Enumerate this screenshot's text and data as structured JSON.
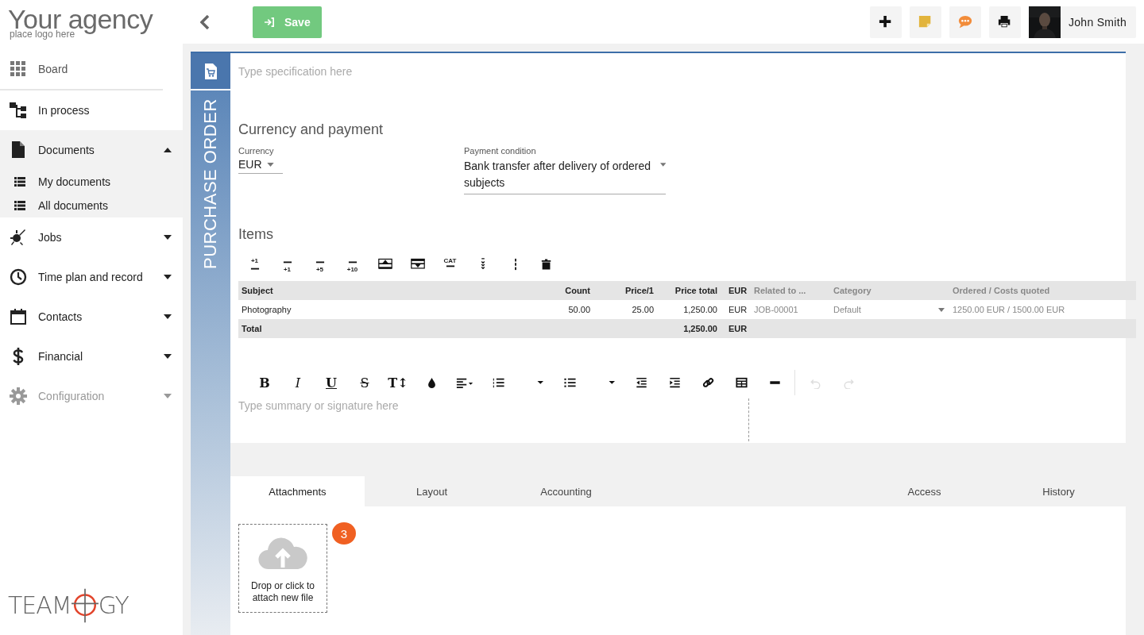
{
  "brand": {
    "title": "Your agency",
    "subtitle": "place logo here"
  },
  "sidebar": {
    "items": [
      {
        "label": "Board",
        "kind": "grid",
        "expanded": false,
        "disabled": false,
        "has_caret": false
      },
      {
        "label": "In process",
        "kind": "flow",
        "expanded": false,
        "disabled": false,
        "has_caret": false
      },
      {
        "label": "Documents",
        "kind": "document",
        "expanded": true,
        "disabled": false,
        "has_caret": true,
        "children": [
          {
            "label": "My documents"
          },
          {
            "label": "All documents"
          }
        ]
      },
      {
        "label": "Jobs",
        "kind": "burst",
        "expanded": false,
        "disabled": false,
        "has_caret": true
      },
      {
        "label": "Time plan and record",
        "kind": "clock",
        "expanded": false,
        "disabled": false,
        "has_caret": true
      },
      {
        "label": "Contacts",
        "kind": "calendar",
        "expanded": false,
        "disabled": false,
        "has_caret": true
      },
      {
        "label": "Financial",
        "kind": "dollar",
        "expanded": false,
        "disabled": false,
        "has_caret": true
      },
      {
        "label": "Configuration",
        "kind": "gear",
        "expanded": false,
        "disabled": true,
        "has_caret": true
      }
    ]
  },
  "footer_logo": {
    "left": "TEAM",
    "right": "GY"
  },
  "toolbar": {
    "save": "Save",
    "user": "John Smith",
    "actions": [
      {
        "kind": "add"
      },
      {
        "kind": "note"
      },
      {
        "kind": "chat"
      },
      {
        "kind": "print"
      }
    ]
  },
  "document": {
    "type_label": "PURCHASE ORDER",
    "specification": {
      "placeholder": "Type specification here"
    },
    "currency_section": {
      "title": "Currency and payment",
      "currency": {
        "label": "Currency",
        "value": "EUR"
      },
      "payment": {
        "label": "Payment condition",
        "value": "Bank transfer after delivery of ordered subjects"
      }
    },
    "items": {
      "title": "Items",
      "tools": [
        {
          "kind": "add-above",
          "label": "+1"
        },
        {
          "kind": "add-below",
          "label": "+1"
        },
        {
          "kind": "add-below",
          "label": "+5"
        },
        {
          "kind": "add-below",
          "label": "+10"
        },
        {
          "kind": "move-up"
        },
        {
          "kind": "move-down"
        },
        {
          "kind": "category",
          "label": "CAT"
        },
        {
          "kind": "expand"
        },
        {
          "kind": "more"
        },
        {
          "kind": "delete"
        }
      ],
      "columns": [
        {
          "label": "Subject",
          "kind": "text"
        },
        {
          "label": "Count",
          "kind": "number"
        },
        {
          "label": "Price/1",
          "kind": "number"
        },
        {
          "label": "Price total",
          "kind": "number"
        },
        {
          "label": "EUR",
          "kind": "unit"
        },
        {
          "label": "Related to ...",
          "kind": "reference"
        },
        {
          "label": "Category",
          "kind": "select"
        },
        {
          "label": "Ordered / Costs quoted",
          "kind": "reference"
        }
      ],
      "rows": [
        {
          "cells": [
            "Photography",
            "50.00",
            "25.00",
            "1,250.00",
            "EUR",
            "JOB-00001",
            "Default",
            "1250.00 EUR / 1500.00 EUR"
          ]
        }
      ],
      "total": {
        "label": "Total",
        "amount": "1,250.00",
        "currency": "EUR"
      }
    },
    "editor": {
      "placeholder": "Type summary or signature here",
      "tools": [
        {
          "kind": "bold",
          "label": "B",
          "disabled": false
        },
        {
          "kind": "italic",
          "label": "I",
          "disabled": false
        },
        {
          "kind": "underline",
          "label": "U",
          "disabled": false
        },
        {
          "kind": "strike",
          "label": "S",
          "disabled": false
        },
        {
          "kind": "size",
          "label": "T↕",
          "disabled": false
        },
        {
          "kind": "color",
          "disabled": false
        },
        {
          "kind": "align",
          "disabled": false
        },
        {
          "kind": "ol",
          "disabled": false
        },
        {
          "kind": "dropdown",
          "disabled": false
        },
        {
          "kind": "ul",
          "disabled": false
        },
        {
          "kind": "dropdown",
          "disabled": false
        },
        {
          "kind": "outdent",
          "disabled": false
        },
        {
          "kind": "indent",
          "disabled": false
        },
        {
          "kind": "link",
          "disabled": false
        },
        {
          "kind": "table",
          "disabled": false
        },
        {
          "kind": "hr",
          "disabled": false
        },
        {
          "kind": "undo",
          "disabled": true
        },
        {
          "kind": "redo",
          "disabled": true
        }
      ]
    }
  },
  "tabs": [
    {
      "label": "Attachments",
      "selected": true
    },
    {
      "label": "Layout",
      "selected": false
    },
    {
      "label": "Accounting",
      "selected": false
    },
    {
      "label": "Access",
      "selected": false
    },
    {
      "label": "History",
      "selected": false
    }
  ],
  "attachments": {
    "drop_text": "Drop or click to attach new file",
    "count": "3"
  }
}
